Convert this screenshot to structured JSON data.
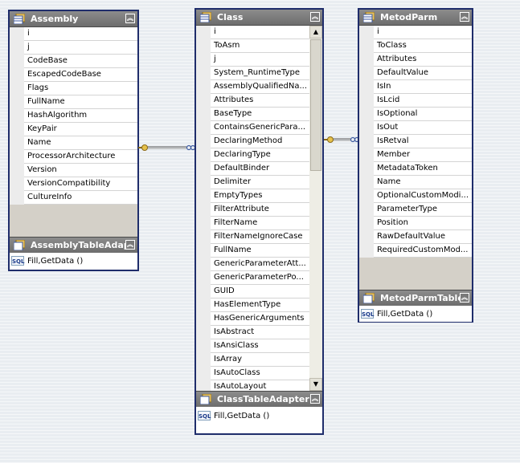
{
  "tables": {
    "assembly": {
      "title": "Assembly",
      "fields": [
        "i",
        "j",
        "CodeBase",
        "EscapedCodeBase",
        "Flags",
        "FullName",
        "HashAlgorithm",
        "KeyPair",
        "Name",
        "ProcessorArchitecture",
        "Version",
        "VersionCompatibility",
        "CultureInfo"
      ],
      "adapter": {
        "title": "AssemblyTableAdap",
        "method": "Fill,GetData ()"
      }
    },
    "class": {
      "title": "Class",
      "fields": [
        "i",
        "ToAsm",
        "j",
        "System_RuntimeType",
        "AssemblyQualifiedNa...",
        "Attributes",
        "BaseType",
        "ContainsGenericPara...",
        "DeclaringMethod",
        "DeclaringType",
        "DefaultBinder",
        "Delimiter",
        "EmptyTypes",
        "FilterAttribute",
        "FilterName",
        "FilterNameIgnoreCase",
        "FullName",
        "GenericParameterAtt...",
        "GenericParameterPo...",
        "GUID",
        "HasElementType",
        "HasGenericArguments",
        "IsAbstract",
        "IsAnsiClass",
        "IsArray",
        "IsAutoClass",
        "IsAutoLayout"
      ],
      "adapter": {
        "title": "ClassTableAdapter",
        "method": "Fill,GetData ()"
      }
    },
    "metodparm": {
      "title": "MetodParm",
      "fields": [
        "i",
        "ToClass",
        "Attributes",
        "DefaultValue",
        "IsIn",
        "IsLcid",
        "IsOptional",
        "IsOut",
        "IsRetval",
        "Member",
        "MetadataToken",
        "Name",
        "OptionalCustomModi...",
        "ParameterType",
        "Position",
        "RawDefaultValue",
        "RequiredCustomMod..."
      ],
      "adapter": {
        "title": "MetodParmTable",
        "method": "Fill,GetData ()"
      }
    }
  },
  "icons": {
    "table": "table-icon",
    "collapse": "collapse-icon",
    "sql": "sql-icon",
    "key": "key-icon",
    "infinity": "infinity-icon"
  },
  "sql_label": "SQL",
  "colors": {
    "border": "#1f2d6b",
    "header": "#7a7a7a",
    "canvas": "#e9edf1"
  }
}
